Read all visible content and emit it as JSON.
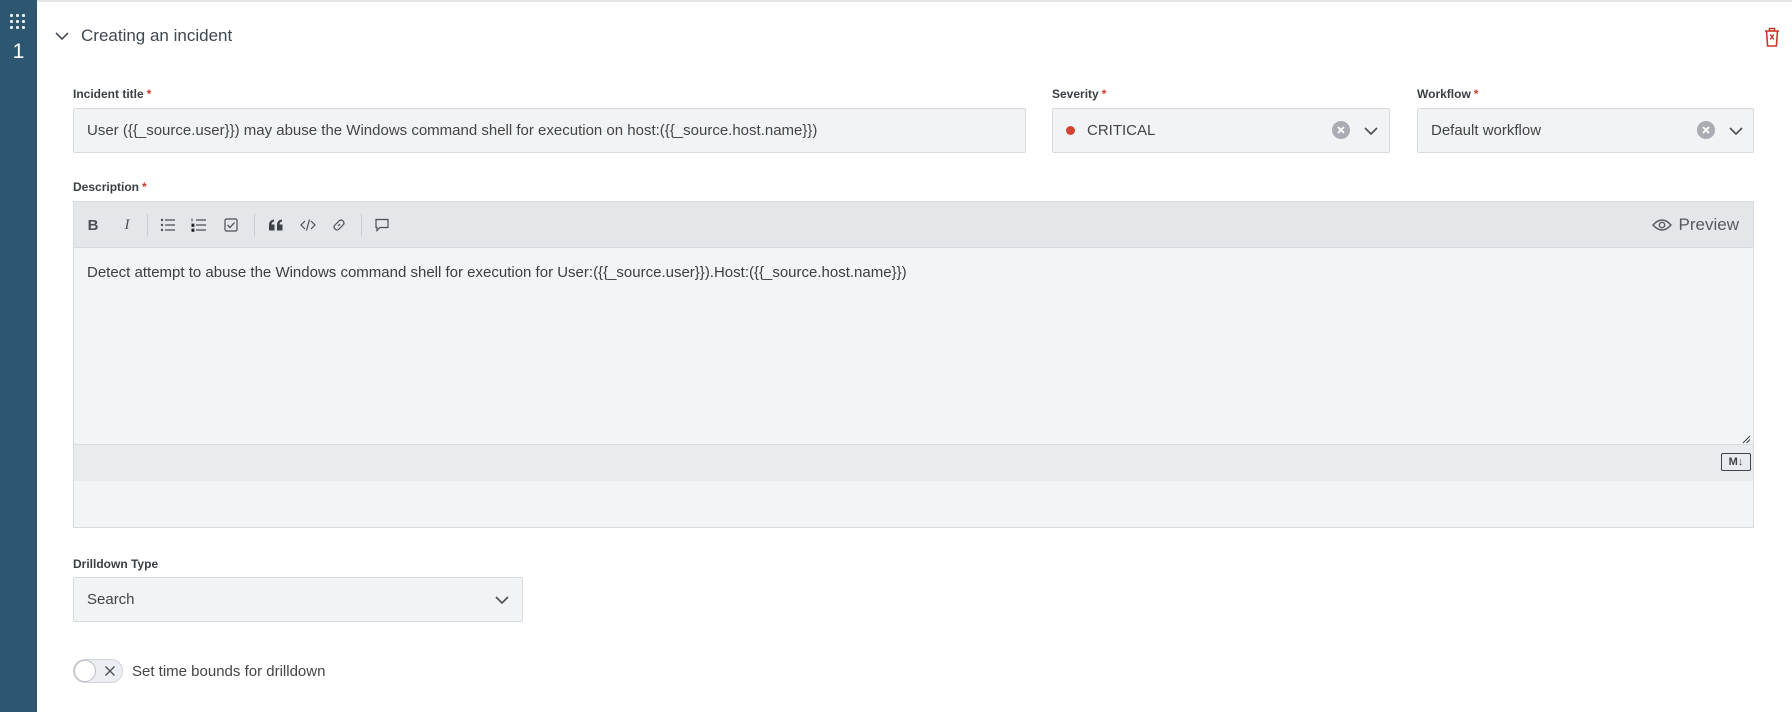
{
  "step": {
    "number": "1"
  },
  "section": {
    "title": "Creating an incident"
  },
  "incident_title": {
    "label": "Incident title",
    "required_mark": "*",
    "value": "User ({{_source.user}}) may abuse the Windows command shell for execution on host:({{_source.host.name}})"
  },
  "severity": {
    "label": "Severity",
    "required_mark": "*",
    "value": "CRITICAL",
    "dot_color": "#d34532"
  },
  "workflow": {
    "label": "Workflow",
    "required_mark": "*",
    "value": "Default workflow"
  },
  "description": {
    "label": "Description",
    "required_mark": "*",
    "toolbar": {
      "bold": "B",
      "italic": "I",
      "preview_label": "Preview"
    },
    "value": "Detect attempt to abuse the Windows command shell for execution for User:({{_source.user}}).Host:({{_source.host.name}})",
    "markdown_badge": "M↓"
  },
  "drilldown": {
    "label": "Drilldown Type",
    "value": "Search"
  },
  "time_bounds": {
    "label": "Set time bounds for drilldown",
    "enabled": false
  },
  "colors": {
    "rail": "#2d5670",
    "required": "#d0382a",
    "trash": "#c9372c"
  }
}
